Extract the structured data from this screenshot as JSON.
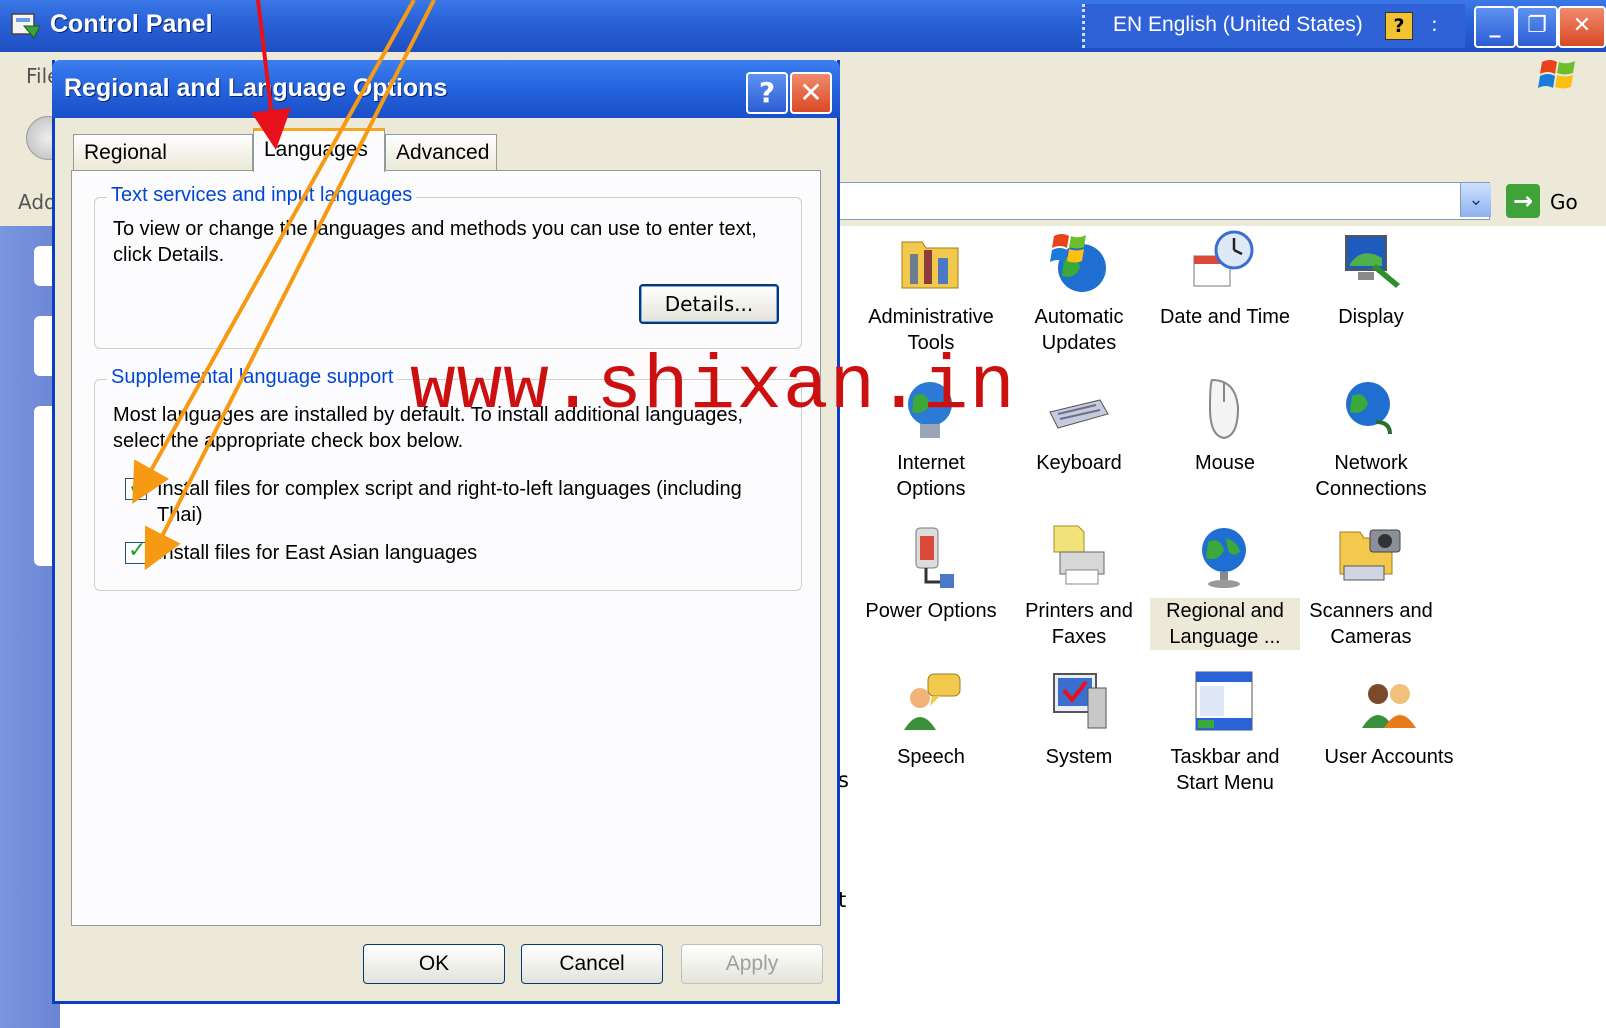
{
  "cp_window": {
    "title": "Control Panel",
    "language_bar": {
      "text": "EN English (United States)",
      "help": "?",
      "options": ":"
    },
    "menu_file": "File",
    "address_label": "Address",
    "go_label": "Go",
    "controls": {
      "minimize": "_",
      "maximize": "❐",
      "close": "✕"
    }
  },
  "cp_icons": [
    {
      "label": "Administrative\nTools",
      "icon": "admin-tools-icon"
    },
    {
      "label": "Automatic\nUpdates",
      "icon": "automatic-updates-icon"
    },
    {
      "label": "Date and Time",
      "icon": "date-time-icon"
    },
    {
      "label": "Display",
      "icon": "display-icon"
    },
    {
      "label": "Internet\nOptions",
      "icon": "internet-options-icon"
    },
    {
      "label": "Keyboard",
      "icon": "keyboard-icon"
    },
    {
      "label": "Mouse",
      "icon": "mouse-icon"
    },
    {
      "label": "Network\nConnections",
      "icon": "network-connections-icon"
    },
    {
      "label": "Power Options",
      "icon": "power-options-icon"
    },
    {
      "label": "Printers and\nFaxes",
      "icon": "printers-faxes-icon"
    },
    {
      "label": "Regional and\nLanguage ...",
      "icon": "regional-language-icon"
    },
    {
      "label": "Scanners and\nCameras",
      "icon": "scanners-cameras-icon"
    },
    {
      "label": "Speech",
      "icon": "speech-icon"
    },
    {
      "label": "System",
      "icon": "system-icon"
    },
    {
      "label": "Taskbar and\nStart Menu",
      "icon": "taskbar-start-menu-icon"
    },
    {
      "label": "User Accounts",
      "icon": "user-accounts-icon"
    }
  ],
  "cp_stray_text": [
    "s",
    "t"
  ],
  "dialog": {
    "title": "Regional and Language Options",
    "help": "?",
    "close": "✕",
    "tabs": [
      "Regional Options",
      "Languages",
      "Advanced"
    ],
    "group1": {
      "title": "Text services and input languages",
      "text": "To view or change the languages and methods you can use to enter text, click Details.",
      "details_button": "Details..."
    },
    "group2": {
      "title": "Supplemental language support",
      "text": "Most languages are installed by default. To install additional languages, select the appropriate check box below.",
      "checkbox1": {
        "label": "Install files for complex script and right-to-left languages (including Thai)",
        "checked": true
      },
      "checkbox2": {
        "label": "Install files for East Asian languages",
        "checked": true
      }
    },
    "buttons": {
      "ok": "OK",
      "cancel": "Cancel",
      "apply": "Apply"
    }
  },
  "watermark": "www.shixan.in",
  "colors": {
    "titlebar": "#2a63d8",
    "dialog_bg": "#ece9d8",
    "group_title": "#0046d5",
    "arrow_red": "#e8101a",
    "arrow_orange": "#f59a12",
    "watermark": "#cc1010"
  }
}
